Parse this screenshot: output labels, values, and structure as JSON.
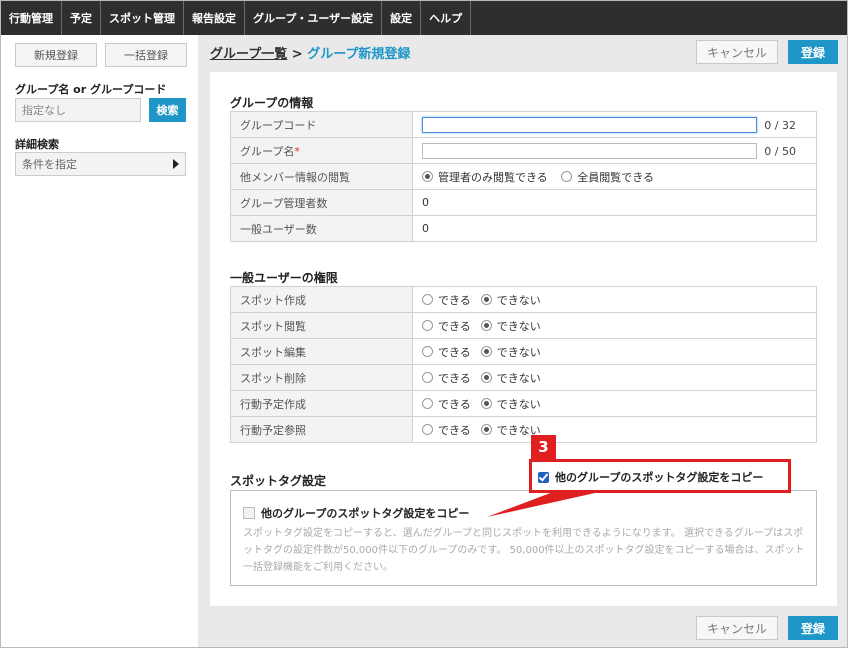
{
  "nav": [
    "行動管理",
    "予定",
    "スポット管理",
    "報告設定",
    "グループ・ユーザー設定",
    "設定",
    "ヘルプ"
  ],
  "sidebar": {
    "new_button": "新規登録",
    "bulk_button": "一括登録",
    "search_label": "グループ名 or グループコード",
    "search_placeholder": "指定なし",
    "search_button": "検索",
    "detail_label": "詳細検索",
    "condition_select": "条件を指定"
  },
  "header": {
    "breadcrumb_home": "グループ一覧",
    "breadcrumb_sep": " > ",
    "breadcrumb_current": "グループ新規登録",
    "cancel_label": "キャンセル",
    "submit_label": "登録"
  },
  "group_info": {
    "title": "グループの情報",
    "code_label": "グループコード",
    "code_value": "",
    "code_counter": "0 / 32",
    "name_label": "グループ名",
    "required_mark": "*",
    "name_value": "",
    "name_counter": "0 / 50",
    "view_label": "他メンバー情報の閲覧",
    "view_option1": "管理者のみ閲覧できる",
    "view_option2": "全員閲覧できる",
    "admin_count_label": "グループ管理者数",
    "admin_count": "0",
    "user_count_label": "一般ユーザー数",
    "user_count": "0"
  },
  "permissions": {
    "title": "一般ユーザーの権限",
    "option_yes": "できる",
    "option_no": "できない",
    "rows": [
      {
        "label": "スポット作成",
        "selected": "no"
      },
      {
        "label": "スポット閲覧",
        "selected": "no"
      },
      {
        "label": "スポット編集",
        "selected": "no"
      },
      {
        "label": "スポット削除",
        "selected": "no"
      },
      {
        "label": "行動予定作成",
        "selected": "no"
      },
      {
        "label": "行動予定参照",
        "selected": "no"
      }
    ]
  },
  "spot_tag": {
    "title": "スポットタグ設定",
    "copy_label": "他のグループのスポットタグ設定をコピー",
    "description": "スポットタグ設定をコピーすると、選んだグループと同じスポットを利用できるようになります。 選択できるグループはスポットタグの設定件数が50,000件以下のグループのみです。 50,000件以上のスポットタグ設定をコピーする場合は、スポット一括登録機能をご利用ください。"
  },
  "callout": {
    "number": "3",
    "checkbox_label": "他のグループのスポットタグ設定をコピー",
    "color": "#e02020"
  },
  "footer": {
    "cancel_label": "キャンセル",
    "submit_label": "登録"
  },
  "colors": {
    "accent": "#1e96c8",
    "nav_bg": "#2e2e2e",
    "required": "#d9312a"
  }
}
